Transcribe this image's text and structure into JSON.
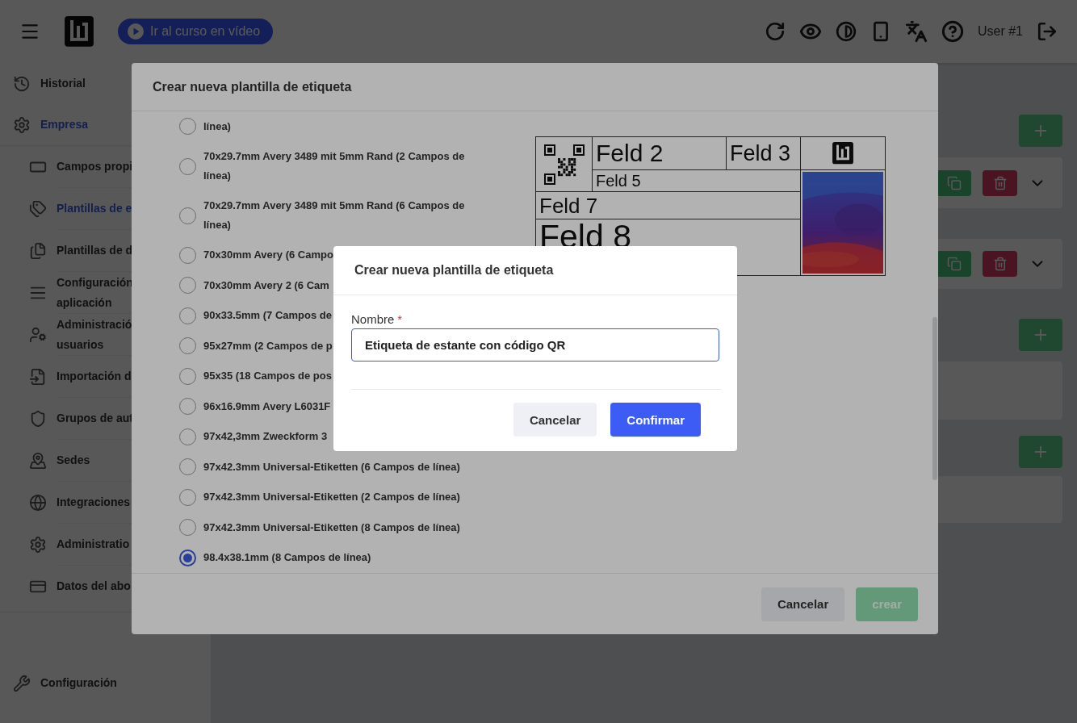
{
  "topbar": {
    "video_button": "Ir al curso en vídeo",
    "user": "User #1"
  },
  "sidebar": {
    "items": [
      {
        "label": "Historial",
        "selected": false
      },
      {
        "label": "Empresa",
        "selected": true,
        "children": [
          {
            "label": "Campos propi",
            "selected": false
          },
          {
            "label": "Plantillas de e",
            "selected": true
          },
          {
            "label": "Plantillas de d",
            "selected": false
          },
          {
            "label": "Configuración aplicación",
            "selected": false
          },
          {
            "label": "Administració usuarios",
            "selected": false
          },
          {
            "label": "Importación d",
            "selected": false
          },
          {
            "label": "Grupos de aut",
            "selected": false
          },
          {
            "label": "Sedes",
            "selected": false
          },
          {
            "label": "Integraciones",
            "selected": false
          },
          {
            "label": "Administratio",
            "selected": false
          },
          {
            "label": "Datos del abo",
            "selected": false
          }
        ]
      },
      {
        "label": "Configuración",
        "selected": false
      }
    ]
  },
  "modal": {
    "title": "Crear nueva plantilla de etiqueta",
    "templates": [
      {
        "label": "línea)",
        "selected": false
      },
      {
        "label": "70x29.7mm Avery 3489 mit 5mm Rand (2 Campos de línea)",
        "selected": false
      },
      {
        "label": "70x29.7mm Avery 3489 mit 5mm Rand (6 Campos de línea)",
        "selected": false
      },
      {
        "label": "70x30mm Avery (6 Campo",
        "selected": false
      },
      {
        "label": "70x30mm Avery 2 (6 Cam",
        "selected": false
      },
      {
        "label": "90x33.5mm (7 Campos de",
        "selected": false
      },
      {
        "label": "95x27mm (2 Campos de p",
        "selected": false
      },
      {
        "label": "95x35 (18 Campos de pos",
        "selected": false
      },
      {
        "label": "96x16.9mm Avery L6031F",
        "selected": false
      },
      {
        "label": "97x42,3mm Zweckform 3",
        "selected": false
      },
      {
        "label": "97x42.3mm Universal-Etiketten (6 Campos de línea)",
        "selected": false
      },
      {
        "label": "97x42.3mm Universal-Etiketten (2 Campos de línea)",
        "selected": false
      },
      {
        "label": "97x42.3mm Universal-Etiketten (8 Campos de línea)",
        "selected": false
      },
      {
        "label": "98.4x38.1mm (8 Campos de línea)",
        "selected": true
      }
    ],
    "preview": {
      "fields": [
        "Feld 2",
        "Feld 3",
        "Feld 5",
        "Feld 7",
        "Feld 8"
      ]
    },
    "buttons": [
      {
        "label": "Cancelar",
        "kind": "secondary"
      },
      {
        "label": "crear",
        "kind": "success",
        "disabled": true
      }
    ]
  },
  "dialog": {
    "title": "Crear nueva plantilla de etiqueta",
    "field": {
      "label": "Nombre",
      "required_mark": "*",
      "value": "Etiqueta de estante con código QR"
    },
    "buttons": [
      {
        "label": "Cancelar",
        "kind": "secondary"
      },
      {
        "label": "Confirmar",
        "kind": "primary"
      }
    ]
  }
}
